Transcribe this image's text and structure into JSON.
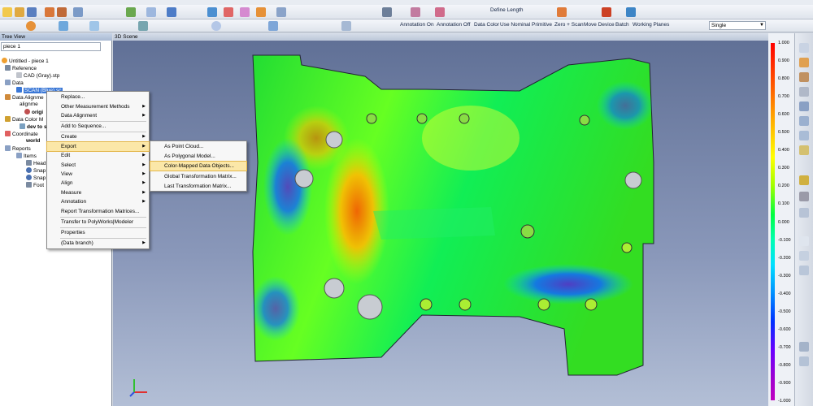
{
  "toolbar": {
    "define_length": "Define Length",
    "annotation_on": "Annotation On",
    "annotation_off": "Annotation Off",
    "data_color": "Data Color",
    "use_nominal": "Use Nominal Primitive",
    "zero_scan": "Zero + Scan",
    "move_device": "Move Device",
    "batch": "Batch",
    "working_planes": "Working Planes",
    "mode_select": "Single"
  },
  "tree": {
    "title": "Tree View",
    "selector": "piece 1",
    "nodes": [
      "Untitled - piece 1",
      "Reference",
      "CAD (Gray).stp",
      "Data",
      "SCAN (Blue).sc",
      "Data Alignme",
      "alignme",
      "origi",
      "Data Color M",
      "dev to s",
      "Coordinate",
      "world",
      "Reports",
      "Items",
      "Head",
      "Snap",
      "Snap",
      "Foot"
    ]
  },
  "context_menu": {
    "items": [
      "Replace...",
      "Other Measurement Methods",
      "Data Alignment",
      "Add to Sequence...",
      "Create",
      "Export",
      "Edit",
      "Select",
      "View",
      "Align",
      "Measure",
      "Annotation",
      "Report Transformation Matrices...",
      "Transfer to PolyWorks|Modeler",
      "Properties",
      "(Data branch)"
    ]
  },
  "export_submenu": {
    "items": [
      "As Point Cloud...",
      "As Polygonal Model...",
      "Color-Mapped Data Objects...",
      "Global Transformation Matrix...",
      "Last Transformation Matrix..."
    ]
  },
  "scene": {
    "title": "3D Scene"
  },
  "color_scale": {
    "ticks": [
      "1.000",
      "0.900",
      "0.800",
      "0.700",
      "0.600",
      "0.500",
      "0.400",
      "0.300",
      "0.200",
      "0.100",
      "0.000",
      "-0.100",
      "-0.200",
      "-0.300",
      "-0.400",
      "-0.500",
      "-0.600",
      "-0.700",
      "-0.800",
      "-0.900",
      "-1.000"
    ]
  },
  "colors": {
    "highlight": "#fbe7a8",
    "selection": "#3a77d6",
    "scene_top": "#5f6f95"
  }
}
